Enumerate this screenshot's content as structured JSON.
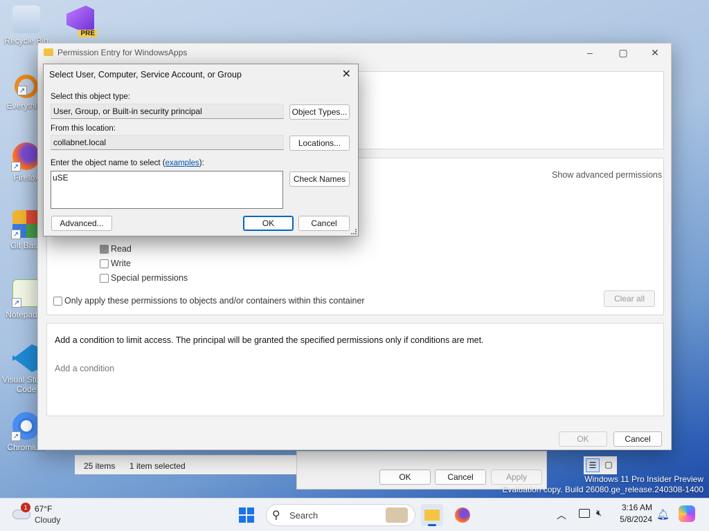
{
  "desktop": {
    "icons": [
      {
        "label": "Recycle Bin"
      },
      {
        "label": "Everything"
      },
      {
        "label": "Firefox"
      },
      {
        "label": "Git Bash"
      },
      {
        "label": "Notepad++"
      },
      {
        "label": "Visual Studio Code"
      },
      {
        "label": "Chromium"
      }
    ],
    "vs_badge": "PRE"
  },
  "explorer": {
    "items_count": "25 items",
    "selected": "1 item selected"
  },
  "properties_dialog": {
    "ok": "OK",
    "cancel": "Cancel",
    "apply": "Apply"
  },
  "watermark": {
    "line1": "Windows 11 Pro Insider Preview",
    "line2": "Evaluation copy. Build 26080.ge_release.240308-1400"
  },
  "permission_entry": {
    "title": "Permission Entry for WindowsApps",
    "show_advanced": "Show advanced permissions",
    "permissions": [
      {
        "label": "Read",
        "checked": true
      },
      {
        "label": "Write",
        "checked": false
      },
      {
        "label": "Special permissions",
        "checked": false
      }
    ],
    "only_apply": "Only apply these permissions to objects and/or containers within this container",
    "clear_all": "Clear all",
    "condition_text": "Add a condition to limit access. The principal will be granted the specified permissions only if conditions are met.",
    "add_condition": "Add a condition",
    "ok": "OK",
    "cancel": "Cancel"
  },
  "select_dialog": {
    "title": "Select User, Computer, Service Account, or Group",
    "object_type_label": "Select this object type:",
    "object_type_value": "User, Group, or Built-in security principal",
    "object_types_btn": "Object Types...",
    "location_label": "From this location:",
    "location_value": "collabnet.local",
    "locations_btn": "Locations...",
    "enter_label_prefix": "Enter the object name to select (",
    "examples_link": "examples",
    "enter_label_suffix": "):",
    "object_name": "uSE",
    "check_names_btn": "Check Names",
    "advanced_btn": "Advanced...",
    "ok": "OK",
    "cancel": "Cancel"
  },
  "taskbar": {
    "weather_temp": "67°F",
    "weather_desc": "Cloudy",
    "weather_badge": "1",
    "search_placeholder": "Search",
    "time": "3:16 AM",
    "date": "5/8/2024"
  }
}
